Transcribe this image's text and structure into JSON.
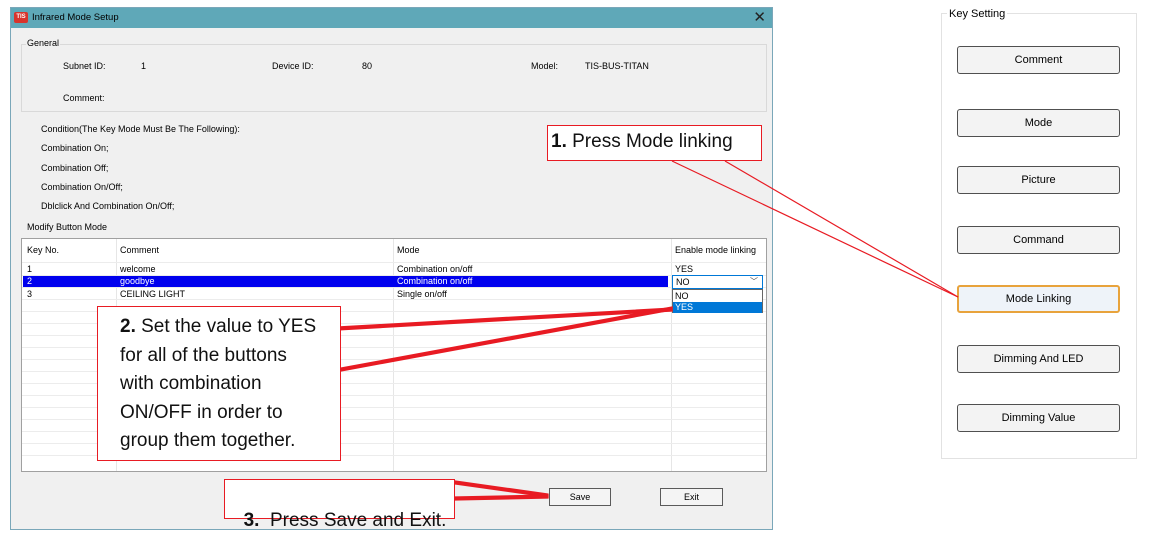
{
  "dialog": {
    "title": "Infrared Mode Setup",
    "icon_text": "TIS",
    "close_glyph": "✕",
    "general": {
      "legend": "General",
      "subnet_label": "Subnet ID:",
      "subnet_value": "1",
      "device_label": "Device ID:",
      "device_value": "80",
      "model_label": "Model:",
      "model_value": "TIS-BUS-TITAN",
      "comment_label": "Comment:"
    },
    "conditions": [
      "Condition(The Key Mode Must Be The Following):",
      "Combination On;",
      "Combination Off;",
      "Combination On/Off;",
      "Dblclick And Combination On/Off;"
    ],
    "modify": {
      "legend": "Modify Button Mode",
      "headers": [
        "Key No.",
        "Comment",
        "Mode",
        "Enable mode linking"
      ],
      "rows": [
        {
          "key": "1",
          "comment": "welcome",
          "mode": "Combination on/off",
          "enable": "YES"
        },
        {
          "key": "2",
          "comment": "goodbye",
          "mode": "Combination on/off",
          "enable": "NO"
        },
        {
          "key": "3",
          "comment": "CEILING LIGHT",
          "mode": "Single on/off",
          "enable": ""
        }
      ],
      "dropdown": {
        "value": "NO",
        "chevron": "﹀",
        "options": [
          "NO",
          "YES"
        ],
        "highlighted": "YES"
      }
    },
    "save_label": "Save",
    "exit_label": "Exit"
  },
  "key_setting": {
    "legend": "Key Setting",
    "buttons": [
      "Comment",
      "Mode",
      "Picture",
      "Command",
      "Mode Linking",
      "Dimming And LED",
      "Dimming Value"
    ],
    "focused": "Mode Linking"
  },
  "callouts": {
    "one_num": "1.",
    "one_text": " Press Mode linking",
    "two_num": "2.",
    "two_line1": " Set the value to YES",
    "two_line2": "for all of the buttons",
    "two_line3": "with combination",
    "two_line4": "ON/OFF in order to",
    "two_line5": "group them together.",
    "three_num": "3.",
    "three_text": "  Press Save and Exit."
  },
  "colors": {
    "titlebar": "#5fa8b8",
    "selection": "#0000ee",
    "highlight": "#0078d7",
    "callout_border": "#e81b23",
    "focus_border": "#e8a33c"
  }
}
